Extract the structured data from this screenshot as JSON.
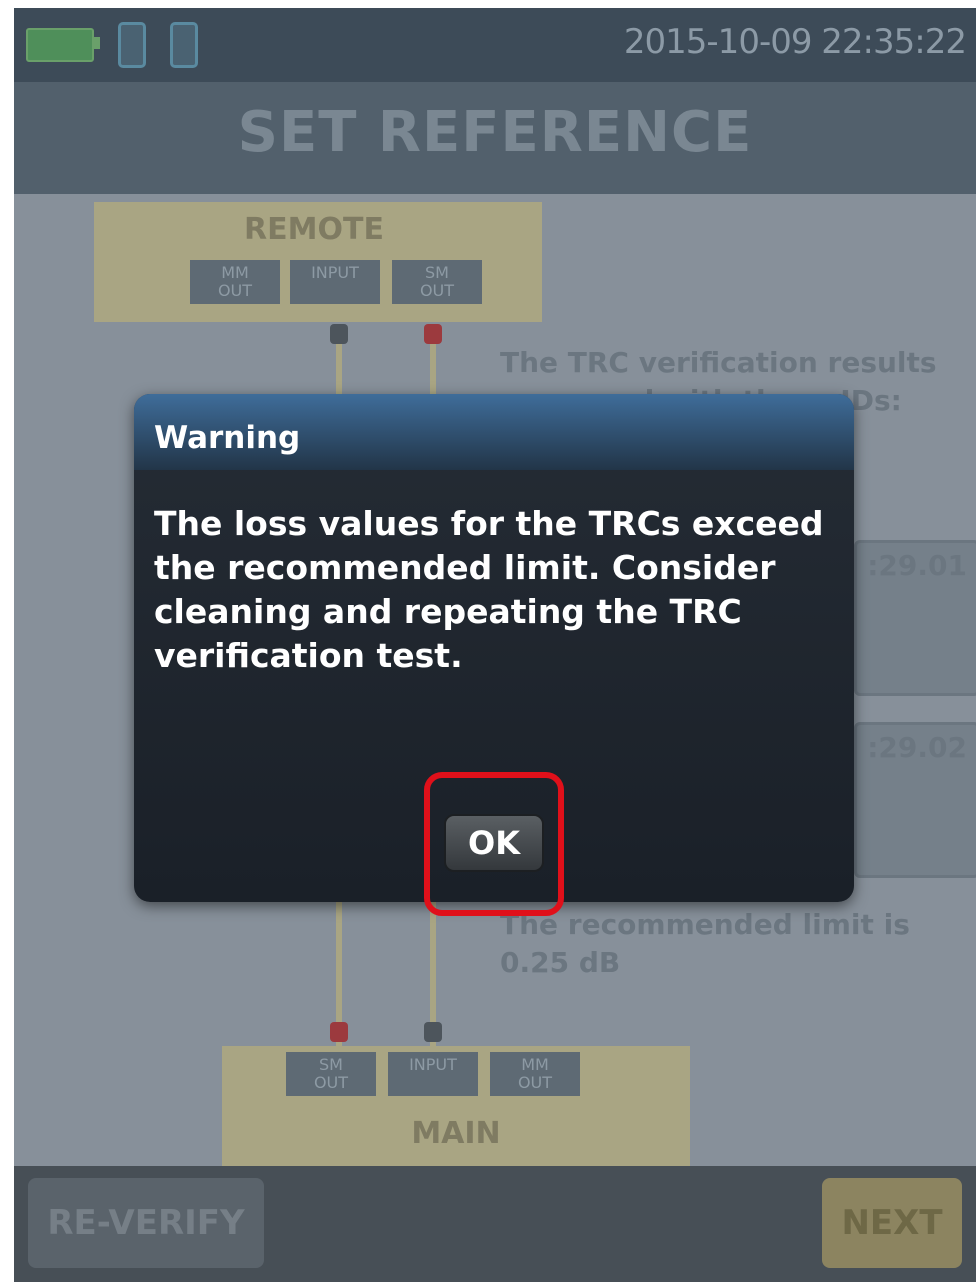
{
  "status_bar": {
    "datetime": "2015-10-09 22:35:22",
    "battery_icon": "battery-icon",
    "connection_icon": "fiber-connection-icon"
  },
  "header": {
    "title": "SET REFERENCE"
  },
  "diagram": {
    "remote": {
      "label": "REMOTE",
      "ports": [
        "MM\nOUT",
        "INPUT",
        "SM\nOUT"
      ]
    },
    "main": {
      "label": "MAIN",
      "ports": [
        "SM\nOUT",
        "INPUT",
        "MM\nOUT"
      ]
    },
    "connector_colors": {
      "mm": "#4d555c",
      "sm": "#9c3a3e"
    }
  },
  "info": {
    "ids_text": "The TRC verification results are saved with these IDs:",
    "id1_value": ":29.01",
    "id2_value": ":29.02",
    "limit_text": "The recommended limit is 0.25 dB"
  },
  "footer": {
    "reverify_label": "RE-VERIFY",
    "next_label": "NEXT"
  },
  "dialog": {
    "title": "Warning",
    "message": "The loss values for the TRCs exceed the recommended limit. Consider cleaning and repeating the TRC verification test.",
    "ok_label": "OK"
  },
  "annotation": {
    "highlight_color": "#e0101a"
  }
}
